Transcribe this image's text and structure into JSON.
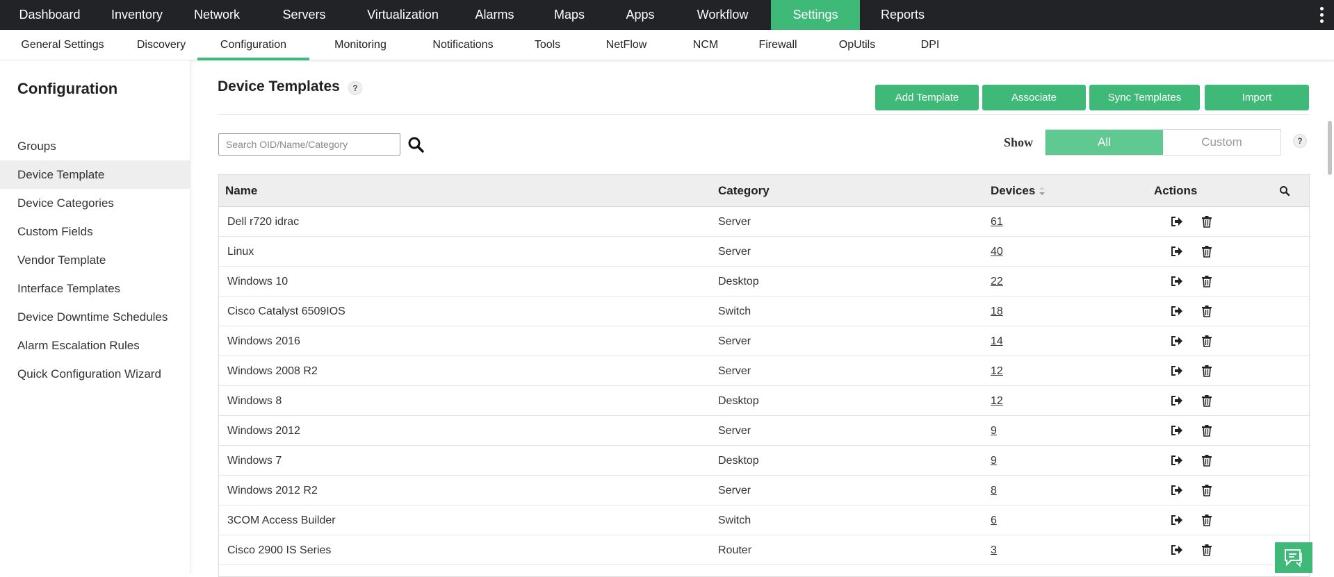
{
  "topnav": {
    "tabs": [
      {
        "label": "Dashboard",
        "active": false
      },
      {
        "label": "Inventory",
        "active": false
      },
      {
        "label": "Network",
        "active": false
      },
      {
        "label": "Servers",
        "active": false
      },
      {
        "label": "Virtualization",
        "active": false
      },
      {
        "label": "Alarms",
        "active": false
      },
      {
        "label": "Maps",
        "active": false
      },
      {
        "label": "Apps",
        "active": false
      },
      {
        "label": "Workflow",
        "active": false
      },
      {
        "label": "Settings",
        "active": true
      },
      {
        "label": "Reports",
        "active": false
      }
    ],
    "more_icon": "kebab-vertical-icon"
  },
  "subnav": {
    "tabs": [
      {
        "label": "General Settings",
        "active": false
      },
      {
        "label": "Discovery",
        "active": false
      },
      {
        "label": "Configuration",
        "active": true
      },
      {
        "label": "Monitoring",
        "active": false
      },
      {
        "label": "Notifications",
        "active": false
      },
      {
        "label": "Tools",
        "active": false
      },
      {
        "label": "NetFlow",
        "active": false
      },
      {
        "label": "NCM",
        "active": false
      },
      {
        "label": "Firewall",
        "active": false
      },
      {
        "label": "OpUtils",
        "active": false
      },
      {
        "label": "DPI",
        "active": false
      }
    ]
  },
  "sidebar": {
    "title": "Configuration",
    "items": [
      {
        "label": "Groups",
        "active": false
      },
      {
        "label": "Device Template",
        "active": true
      },
      {
        "label": "Device Categories",
        "active": false
      },
      {
        "label": "Custom Fields",
        "active": false
      },
      {
        "label": "Vendor Template",
        "active": false
      },
      {
        "label": "Interface Templates",
        "active": false
      },
      {
        "label": "Device Downtime Schedules",
        "active": false
      },
      {
        "label": "Alarm Escalation Rules",
        "active": false
      },
      {
        "label": "Quick Configuration Wizard",
        "active": false
      }
    ]
  },
  "main": {
    "title": "Device Templates",
    "help": "?",
    "buttons": {
      "add_template": "Add Template",
      "associate": "Associate",
      "sync_templates": "Sync Templates",
      "import": "Import"
    },
    "search": {
      "placeholder": "Search OID/Name/Category",
      "value": ""
    },
    "show": {
      "label": "Show",
      "options": [
        "All",
        "Custom"
      ],
      "selected": "All"
    },
    "table": {
      "columns": {
        "name": "Name",
        "category": "Category",
        "devices": "Devices",
        "actions": "Actions"
      },
      "rows": [
        {
          "name": "Dell r720 idrac",
          "category": "Server",
          "devices": "61"
        },
        {
          "name": "Linux",
          "category": "Server",
          "devices": "40"
        },
        {
          "name": "Windows 10",
          "category": "Desktop",
          "devices": "22"
        },
        {
          "name": "Cisco Catalyst 6509IOS",
          "category": "Switch",
          "devices": "18"
        },
        {
          "name": "Windows 2016",
          "category": "Server",
          "devices": "14"
        },
        {
          "name": "Windows 2008 R2",
          "category": "Server",
          "devices": "12"
        },
        {
          "name": "Windows 8",
          "category": "Desktop",
          "devices": "12"
        },
        {
          "name": "Windows 2012",
          "category": "Server",
          "devices": "9"
        },
        {
          "name": "Windows 7",
          "category": "Desktop",
          "devices": "9"
        },
        {
          "name": "Windows 2012 R2",
          "category": "Server",
          "devices": "8"
        },
        {
          "name": "3COM Access Builder",
          "category": "Switch",
          "devices": "6"
        },
        {
          "name": "Cisco 2900 IS Series",
          "category": "Router",
          "devices": "3"
        }
      ]
    }
  },
  "colors": {
    "accent": "#3fb978",
    "toggle_active": "#60c991",
    "topbar": "#222326"
  }
}
